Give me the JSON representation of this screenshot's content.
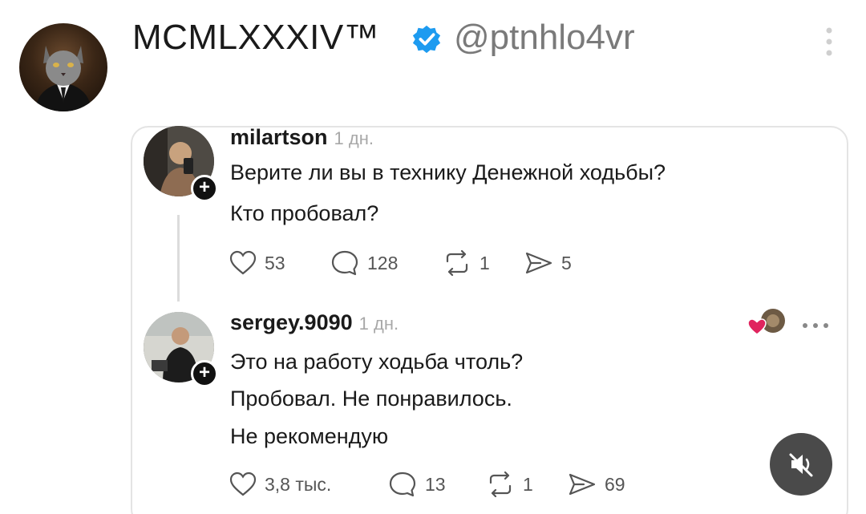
{
  "post": {
    "author_name": "MCMLXXXIV™",
    "author_handle": "@ptnhlo4vr",
    "author_avatar_icon": "cat-in-suit-avatar",
    "verified_icon": "verified-badge-icon",
    "menu_icon": "more-vertical-icon"
  },
  "comments": [
    {
      "username": "milartson",
      "time": "1 дн.",
      "lines": [
        "Верите ли вы в технику Денежной ходьбы?",
        "Кто пробовал?"
      ],
      "stats": {
        "likes": "53",
        "replies": "128",
        "reposts": "1",
        "shares": "5"
      }
    },
    {
      "username": "sergey.9090",
      "time": "1 дн.",
      "lines": [
        "Это на работу ходьба чтоль?",
        "Пробовал. Не понравилось.",
        "Не рекомендую"
      ],
      "stats": {
        "likes": "3,8 тыс.",
        "replies": "13",
        "reposts": "1",
        "shares": "69"
      }
    }
  ],
  "colors": {
    "verified": "#1d9bf0",
    "heart_reaction": "#e0245e",
    "mute_button": "#4a4a4a"
  },
  "mute_icon": "speaker-muted-icon"
}
